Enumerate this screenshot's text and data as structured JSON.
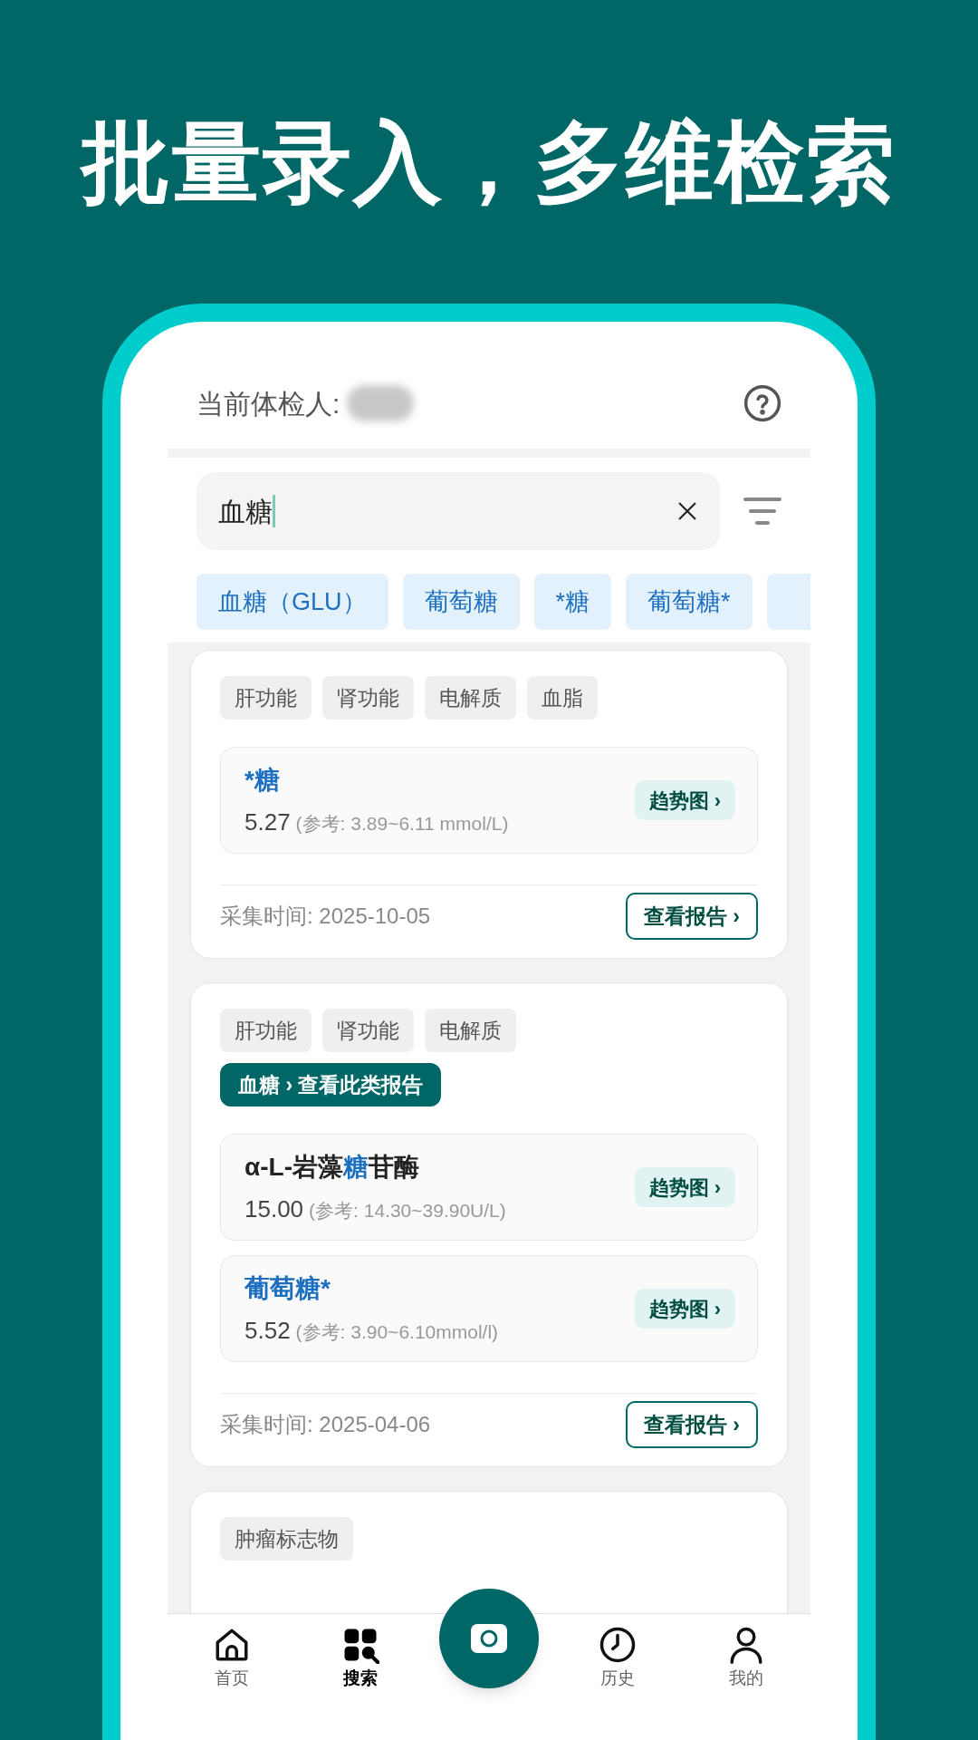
{
  "headline": "批量录入，多维检索",
  "header": {
    "label": "当前体检人:"
  },
  "search": {
    "value": "血糖"
  },
  "suggestions": [
    {
      "label": "血糖（GLU）"
    },
    {
      "label": "葡萄糖"
    },
    {
      "label": "*糖"
    },
    {
      "label": "葡萄糖*"
    }
  ],
  "records": [
    {
      "tags": [
        "肝功能",
        "肾功能",
        "电解质",
        "血脂"
      ],
      "items": [
        {
          "name": [
            {
              "text": "*糖",
              "match": true
            }
          ],
          "value": "5.27",
          "reference": "(参考: 3.89~6.11 mmol/L)",
          "trend": "趋势图 ›"
        }
      ],
      "date": "采集时间: 2025-10-05",
      "report_button": "查看报告 ›"
    },
    {
      "tags": [
        "肝功能",
        "肾功能",
        "电解质"
      ],
      "category_link": "血糖 › 查看此类报告",
      "items": [
        {
          "name": [
            {
              "text": "α-L-岩藻",
              "match": false
            },
            {
              "text": "糖",
              "match": true
            },
            {
              "text": "苷酶",
              "match": false
            }
          ],
          "value": "15.00",
          "reference": "(参考: 14.30~39.90U/L)",
          "trend": "趋势图 ›"
        },
        {
          "name": [
            {
              "text": "葡萄糖*",
              "match": true
            }
          ],
          "value": "5.52",
          "reference": "(参考: 3.90~6.10mmol/l)",
          "trend": "趋势图 ›"
        }
      ],
      "date": "采集时间: 2025-04-06",
      "report_button": "查看报告 ›"
    },
    {
      "tags": [
        "肿瘤标志物"
      ]
    }
  ],
  "nav": [
    {
      "kind": "home",
      "label": "首页",
      "selected": false
    },
    {
      "kind": "search",
      "label": "搜索",
      "selected": true
    },
    {
      "kind": "camera"
    },
    {
      "kind": "history",
      "label": "历史",
      "selected": false
    },
    {
      "kind": "profile",
      "label": "我的",
      "selected": false
    }
  ]
}
